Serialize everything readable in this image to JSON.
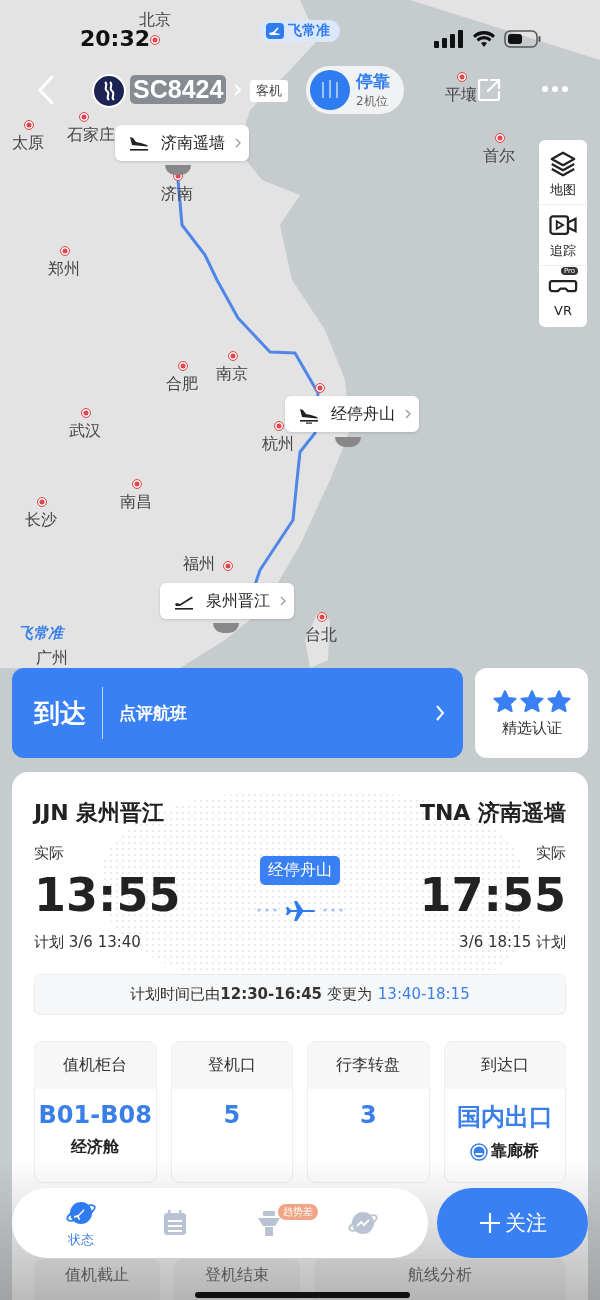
{
  "status_bar": {
    "time": "20:32"
  },
  "app_badge": {
    "label": "飞常准"
  },
  "header": {
    "flight_number": "SC8424",
    "aircraft_tag": "客机"
  },
  "stand_popup": {
    "title": "停靠",
    "subtitle": "2机位"
  },
  "map": {
    "cities": [
      "北京",
      "石家庄",
      "太原",
      "济南",
      "郑州",
      "合肥",
      "南京",
      "杭州",
      "武汉",
      "南昌",
      "长沙",
      "福州",
      "台北",
      "平壤",
      "首尔",
      "广州"
    ],
    "airports": [
      {
        "kind": "arrival",
        "name": "济南遥墙"
      },
      {
        "kind": "stopover",
        "name": "经停舟山"
      },
      {
        "kind": "departure",
        "name": "泉州晋江"
      }
    ],
    "logo": "飞常准",
    "tools": [
      {
        "kind": "layers",
        "label": "地图"
      },
      {
        "kind": "video",
        "label": "追踪"
      },
      {
        "kind": "vr",
        "label": "VR",
        "badge": "Pro"
      }
    ]
  },
  "status_card": {
    "status": "到达",
    "action": "点评航班"
  },
  "certification": {
    "stars": 3,
    "label": "精选认证"
  },
  "flight": {
    "origin": {
      "code": "JJN",
      "name": "泉州晋江",
      "time_label": "实际",
      "time": "13:55",
      "planned": "计划 3/6 13:40"
    },
    "destination": {
      "code": "TNA",
      "name": "济南遥墙",
      "time_label": "实际",
      "time": "17:55",
      "planned": "3/6 18:15 计划"
    },
    "stopover": "经停舟山",
    "notice": "计划时间已由**12:30-16:45** 变更为",
    "notice_new_time": "13:40-18:15"
  },
  "info_tiles": [
    {
      "label": "值机柜台",
      "value": "B01-B08",
      "sub": "经济舱"
    },
    {
      "label": "登机口",
      "value": "5"
    },
    {
      "label": "行李转盘",
      "value": "3"
    },
    {
      "label": "到达口",
      "value": "国内出口",
      "sub": "靠廊桥",
      "sub_icon": true
    }
  ],
  "more_tiles": [
    "值机截止",
    "登机结束",
    "航线分析"
  ],
  "bottom_nav": [
    {
      "kind": "status",
      "label": "状态",
      "selected": true
    },
    {
      "kind": "calendar",
      "selected": false
    },
    {
      "kind": "tower",
      "badge": "趋势差",
      "selected": false
    },
    {
      "kind": "planet",
      "selected": false
    }
  ],
  "follow_button": "关注"
}
